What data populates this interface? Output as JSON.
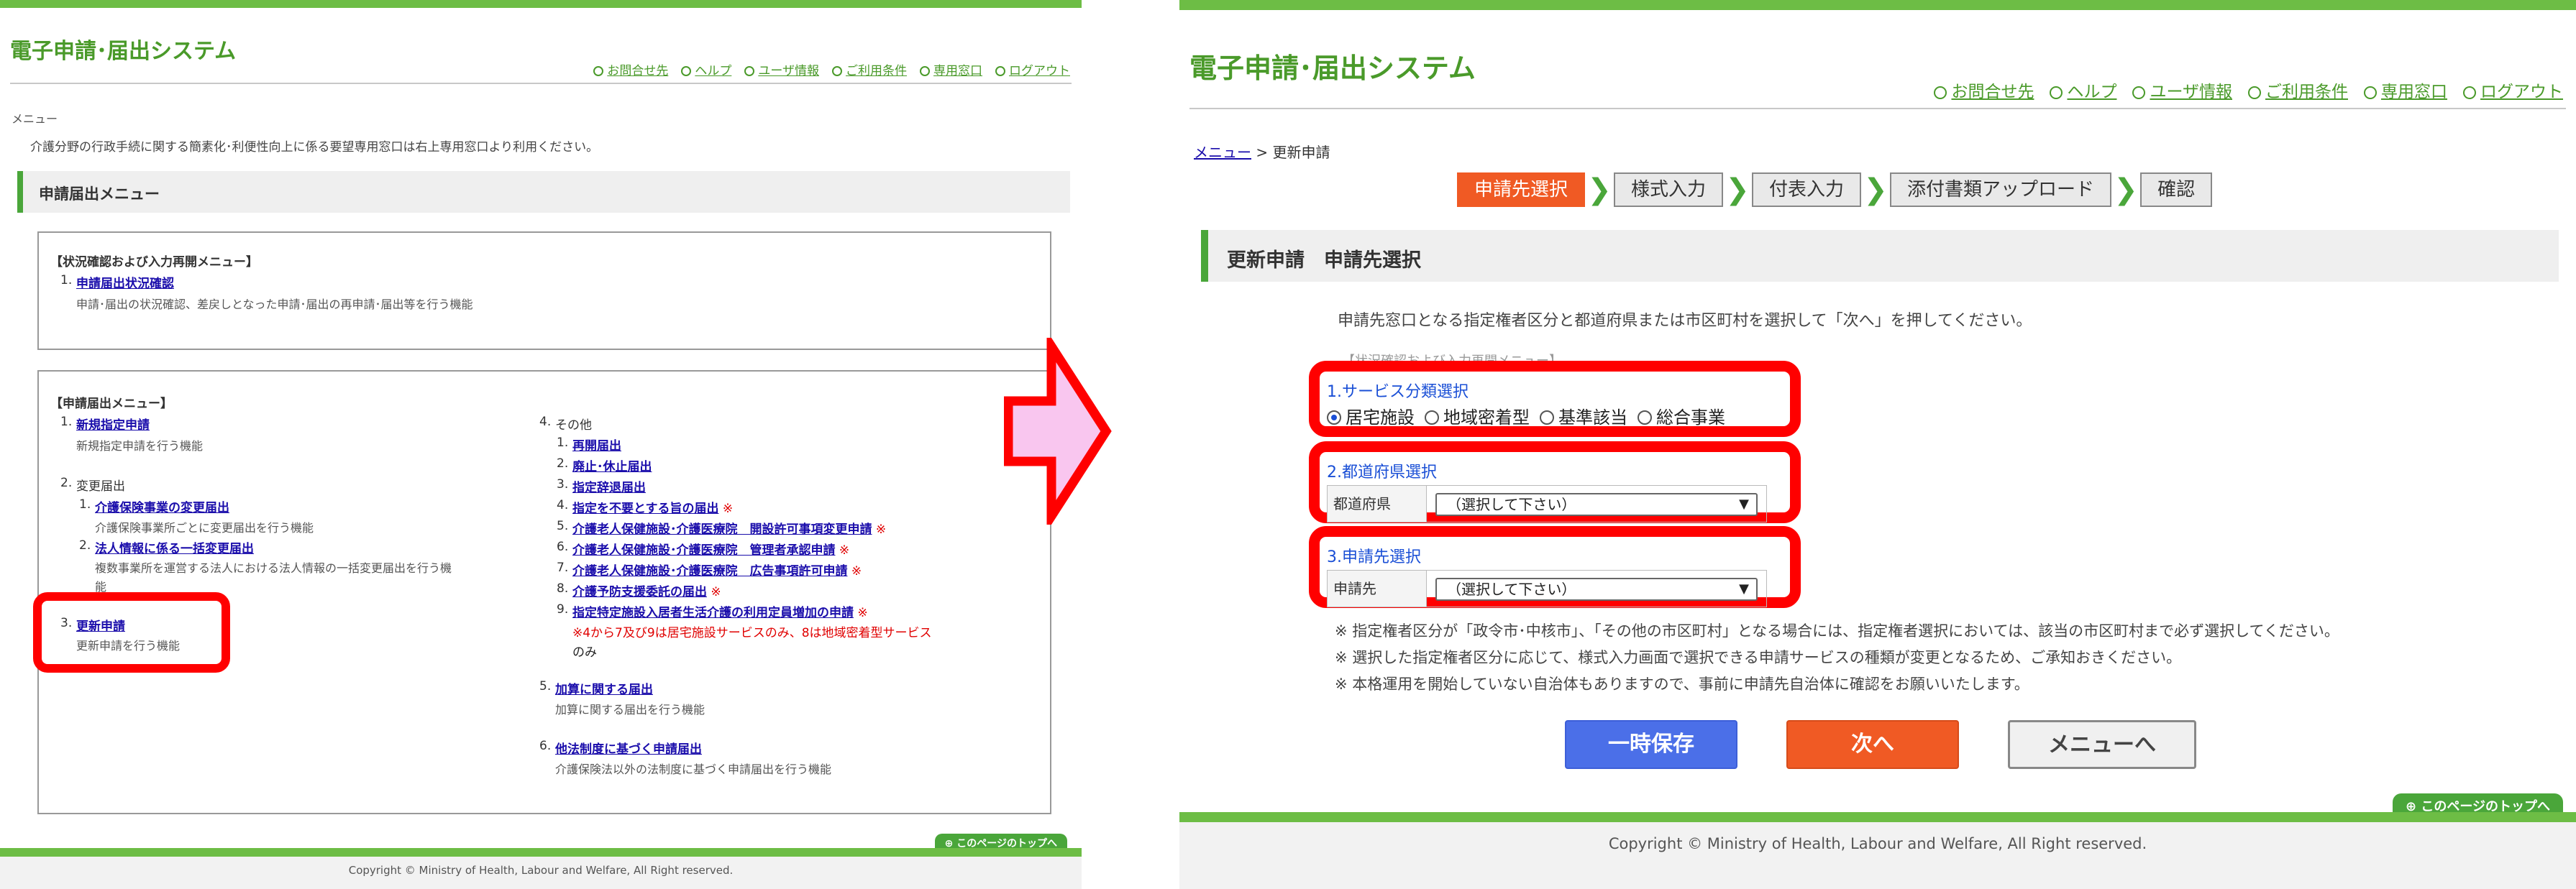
{
  "app_title": "電子申請･届出システム",
  "top_links": [
    "お問合せ先",
    "ヘルプ",
    "ユーザ情報",
    "ご利用条件",
    "専用窓口",
    "ログアウト"
  ],
  "footer": {
    "copyright": "Copyright © Ministry of Health, Labour and Welfare, All Right reserved.",
    "to_top": "このページのトップへ"
  },
  "left": {
    "breadcrumb": "メニュー",
    "intro": "介護分野の行政手続に関する簡素化･利便性向上に係る要望専用窓口は右上専用窓口より利用ください。",
    "section_title": "申請届出メニュー",
    "box1": {
      "heading": "【状況確認および入力再開メニュー】",
      "item1_num": "1.",
      "item1_link": "申請届出状況確認",
      "item1_desc": "申請･届出の状況確認、差戻しとなった申請･届出の再申請･届出等を行う機能"
    },
    "box2": {
      "heading": "【申請届出メニュー】",
      "i1_num": "1.",
      "i1_link": "新規指定申請",
      "i1_desc": "新規指定申請を行う機能",
      "i2_num": "2.",
      "i2_label": "変更届出",
      "i2a_num": "1.",
      "i2a_link": "介護保険事業の変更届出",
      "i2a_desc": "介護保険事業所ごとに変更届出を行う機能",
      "i2b_num": "2.",
      "i2b_link": "法人情報に係る一括変更届出",
      "i2b_desc1": "複数事業所を運営する法人における法人情報の一括変更届出を行う機",
      "i2b_desc2": "能",
      "i3_num": "3.",
      "i3_link": "更新申請",
      "i3_desc": "更新申請を行う機能",
      "i4_num": "4.",
      "i4_label": "その他",
      "o1": "再開届出",
      "o2": "廃止･休止届出",
      "o3": "指定辞退届出",
      "o4": "指定を不要とする旨の届出",
      "o5": "介護老人保健施設･介護医療院　開設許可事項変更申請",
      "o6": "介護老人保健施設･介護医療院　管理者承認申請",
      "o7": "介護老人保健施設･介護医療院　広告事項許可申請",
      "o8": "介護予防支援委託の届出",
      "o9": "指定特定施設入居者生活介護の利用定員増加の申請",
      "o_nums": [
        "1.",
        "2.",
        "3.",
        "4.",
        "5.",
        "6.",
        "7.",
        "8.",
        "9."
      ],
      "mark": "※",
      "o_note1": "※4から7及び9は居宅施設サービスのみ、8は地域密着型サービス",
      "o_note2": "のみ",
      "i5_num": "5.",
      "i5_link": "加算に関する届出",
      "i5_desc": "加算に関する届出を行う機能",
      "i6_num": "6.",
      "i6_link": "他法制度に基づく申請届出",
      "i6_desc": "介護保険法以外の法制度に基づく申請届出を行う機能"
    }
  },
  "right": {
    "breadcrumb_menu": "メニュー",
    "breadcrumb_sep": ">",
    "breadcrumb_current": "更新申請",
    "steps": [
      {
        "label": "申請先選択",
        "active": true
      },
      {
        "label": "様式入力",
        "active": false
      },
      {
        "label": "付表入力",
        "active": false
      },
      {
        "label": "添付書類アップロード",
        "active": false
      },
      {
        "label": "確認",
        "active": false
      }
    ],
    "step_arrow": "❯",
    "section_title": "更新申請　申請先選択",
    "description": "申請先窓口となる指定権者区分と都道府県または市区町村を選択して「次へ」を押してください。",
    "ghost_text": "【状況確認および入力再開メニュー】",
    "service": {
      "label": "1.サービス分類選択",
      "options": [
        "居宅施設",
        "地域密着型",
        "基準該当",
        "総合事業"
      ],
      "selected": "居宅施設"
    },
    "prefecture": {
      "label": "2.都道府県選択",
      "row_label": "都道府県",
      "value": "（選択して下さい）"
    },
    "destination": {
      "label": "3.申請先選択",
      "row_label": "申請先",
      "value": "（選択して下さい）"
    },
    "notes": [
      "※ 指定権者区分が「政令市･中核市」、「その他の市区町村」となる場合には、指定権者選択においては、該当の市区町村まで必ず選択してください。",
      "※ 選択した指定権者区分に応じて、様式入力画面で選択できる申請サービスの種類が変更となるため、ご承知おきください。",
      "※ 本格運用を開始していない自治体もありますので、事前に申請先自治体に確認をお願いいたします。"
    ],
    "buttons": {
      "save": "一時保存",
      "next": "次へ",
      "menu": "メニューへ"
    }
  },
  "colors": {
    "brand_green": "#6dbd45",
    "highlight_red": "#ff0000",
    "arrow_fill": "#f9c6ef",
    "active_step": "#f05a24",
    "save_button": "#4b6fe8"
  },
  "icons": [
    "circle-arrow-icon",
    "radio-icon",
    "chevron-down-icon",
    "step-arrow-icon",
    "big-right-arrow-icon"
  ]
}
